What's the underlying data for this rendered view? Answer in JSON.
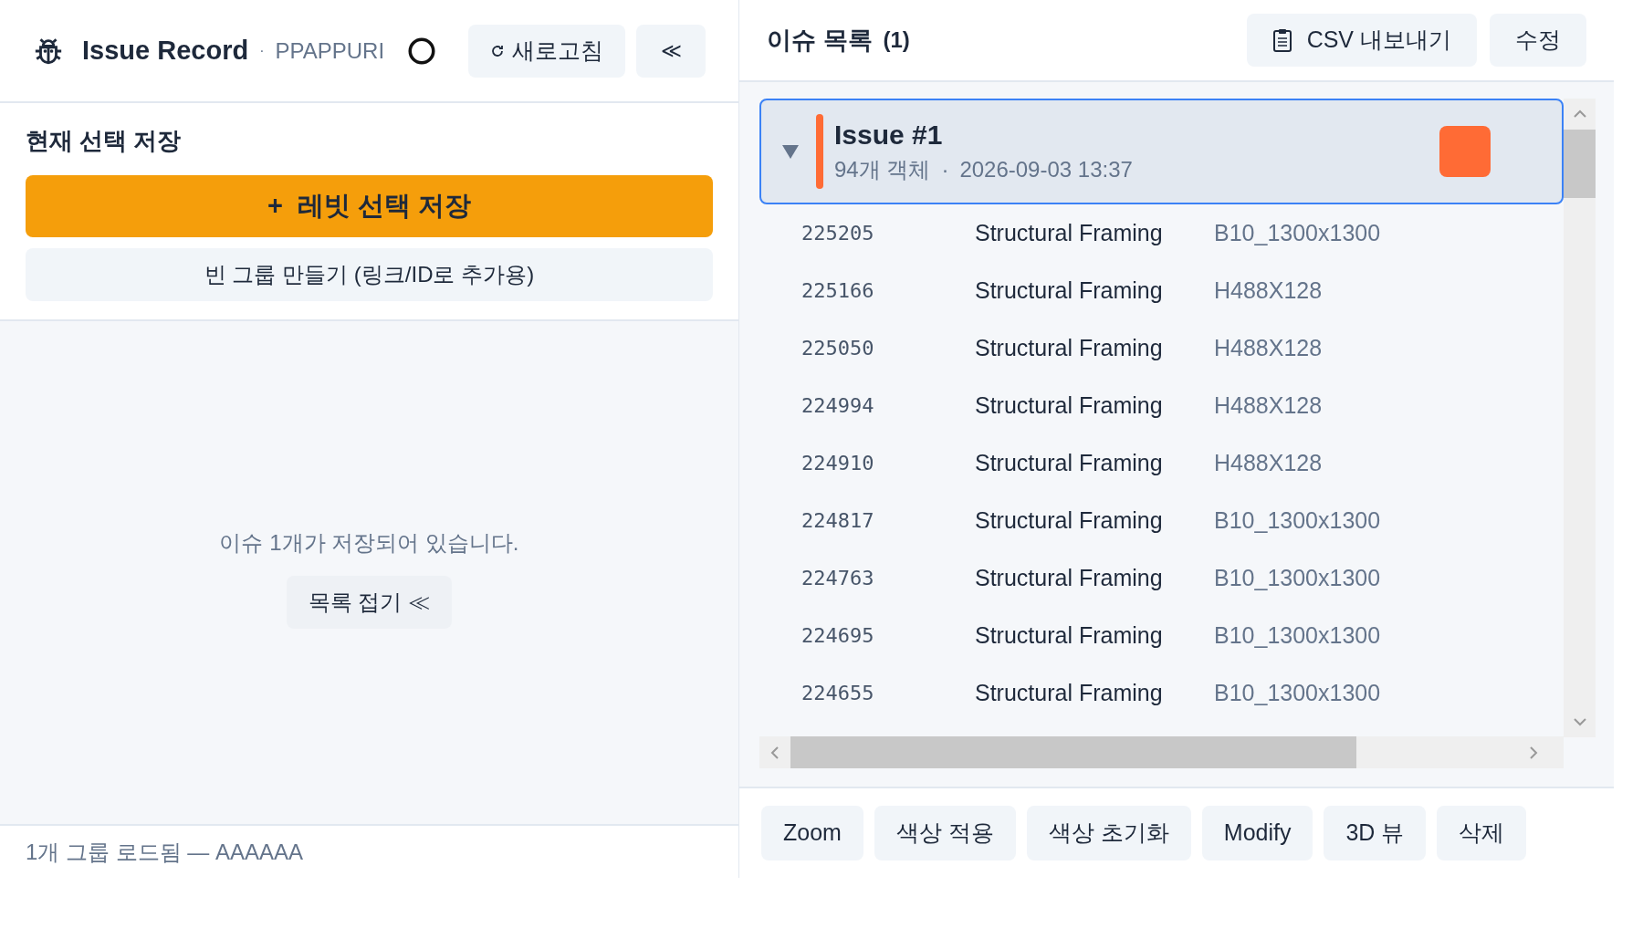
{
  "header": {
    "title": "Issue Record",
    "separator": "·",
    "project": "PPAPPURI",
    "refresh_button": "새로고침",
    "collapse_button": "≪"
  },
  "save_section": {
    "title": "현재 선택 저장",
    "save_button": "+  레빗 선택 저장",
    "empty_group_button": "빈 그룹 만들기 (링크/ID로 추가용)"
  },
  "info": {
    "message": "이슈 1개가 저장되어 있습니다.",
    "collapse_list_button": "목록 접기 ≪"
  },
  "status_bar": "1개 그룹 로드됨 — AAAAAA",
  "issue_list": {
    "title": "이슈 목록",
    "count": "(1)",
    "csv_button": "CSV 내보내기",
    "edit_button": "수정",
    "issues": [
      {
        "title": "Issue #1",
        "object_count": "94개 객체",
        "separator": "·",
        "date": "2026-09-03 13:37",
        "color": "#ff6b35",
        "expanded": true,
        "selected": true,
        "rows": [
          {
            "id": "225205",
            "category": "Structural Framing",
            "type": "B10_1300x1300"
          },
          {
            "id": "225166",
            "category": "Structural Framing",
            "type": "H488X128"
          },
          {
            "id": "225050",
            "category": "Structural Framing",
            "type": "H488X128"
          },
          {
            "id": "224994",
            "category": "Structural Framing",
            "type": "H488X128"
          },
          {
            "id": "224910",
            "category": "Structural Framing",
            "type": "H488X128"
          },
          {
            "id": "224817",
            "category": "Structural Framing",
            "type": "B10_1300x1300"
          },
          {
            "id": "224763",
            "category": "Structural Framing",
            "type": "B10_1300x1300"
          },
          {
            "id": "224695",
            "category": "Structural Framing",
            "type": "B10_1300x1300"
          },
          {
            "id": "224655",
            "category": "Structural Framing",
            "type": "B10_1300x1300"
          }
        ]
      }
    ]
  },
  "actions": [
    "Zoom",
    "색상 적용",
    "색상 초기화",
    "Modify",
    "3D 뷰",
    "삭제"
  ]
}
